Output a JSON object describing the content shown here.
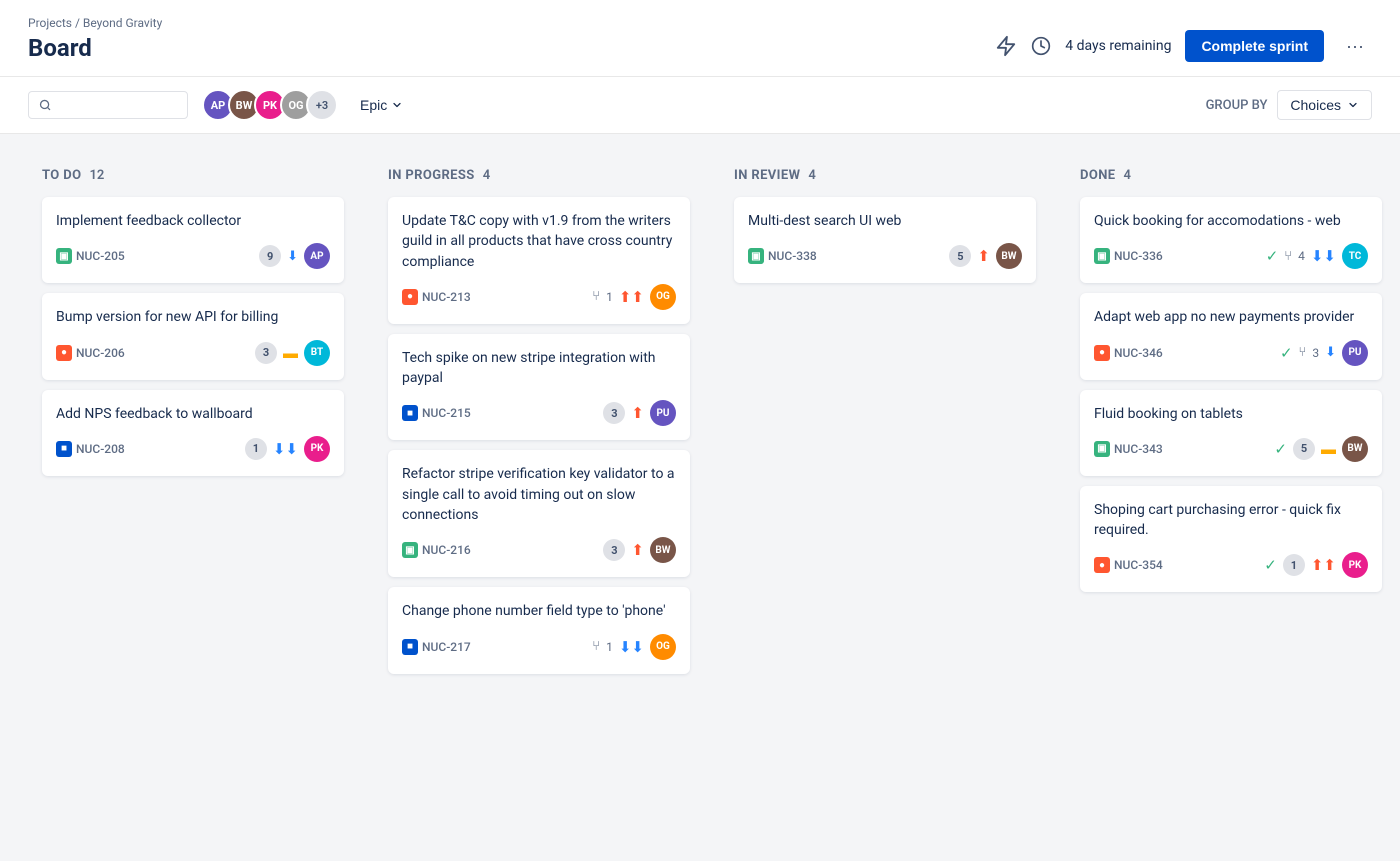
{
  "breadcrumb": "Projects / Beyond Gravity",
  "page_title": "Board",
  "sprint_timer": "4 days remaining",
  "complete_sprint_label": "Complete sprint",
  "more_options_label": "···",
  "toolbar": {
    "search_placeholder": "",
    "epic_label": "Epic",
    "group_by_label": "GROUP BY",
    "choices_label": "Choices",
    "avatar_extra": "+3"
  },
  "columns": [
    {
      "id": "todo",
      "title": "TO DO",
      "count": 12,
      "cards": [
        {
          "id": "c1",
          "title": "Implement feedback collector",
          "issue_id": "NUC-205",
          "issue_type": "story",
          "story_points": 9,
          "priority": "down",
          "avatar_color": "av-purple",
          "avatar_initials": "AP"
        },
        {
          "id": "c2",
          "title": "Bump version for new API for billing",
          "issue_id": "NUC-206",
          "issue_type": "bug",
          "story_points": 3,
          "priority": "medium",
          "avatar_color": "av-teal",
          "avatar_initials": "BT"
        },
        {
          "id": "c3",
          "title": "Add NPS feedback to wallboard",
          "issue_id": "NUC-208",
          "issue_type": "task",
          "story_points": 1,
          "priority": "low",
          "avatar_color": "av-pink",
          "avatar_initials": "PK"
        }
      ]
    },
    {
      "id": "inprogress",
      "title": "IN PROGRESS",
      "count": 4,
      "cards": [
        {
          "id": "c4",
          "title": "Update T&C copy with v1.9 from the writers guild in all products that have cross country compliance",
          "issue_id": "NUC-213",
          "issue_type": "bug",
          "story_points": null,
          "has_branch": true,
          "branch_count": 1,
          "priority": "highest",
          "avatar_color": "av-orange",
          "avatar_initials": "OG"
        },
        {
          "id": "c5",
          "title": "Tech spike on new stripe integration with paypal",
          "issue_id": "NUC-215",
          "issue_type": "task",
          "story_points": 3,
          "priority": "high",
          "avatar_color": "av-purple",
          "avatar_initials": "PU"
        },
        {
          "id": "c6",
          "title": "Refactor stripe verification key validator to a single call to avoid timing out on slow connections",
          "issue_id": "NUC-216",
          "issue_type": "story",
          "story_points": 3,
          "priority": "high",
          "avatar_color": "av-brown",
          "avatar_initials": "BW"
        },
        {
          "id": "c7",
          "title": "Change phone number field type to 'phone'",
          "issue_id": "NUC-217",
          "issue_type": "task",
          "story_points": null,
          "has_branch": true,
          "branch_count": 1,
          "priority": "low",
          "avatar_color": "av-orange",
          "avatar_initials": "OG"
        }
      ]
    },
    {
      "id": "inreview",
      "title": "IN REVIEW",
      "count": 4,
      "cards": [
        {
          "id": "c8",
          "title": "Multi-dest search UI web",
          "issue_id": "NUC-338",
          "issue_type": "story",
          "story_points": 5,
          "priority": "high",
          "avatar_color": "av-brown",
          "avatar_initials": "BW"
        }
      ]
    },
    {
      "id": "done",
      "title": "DONE",
      "count": 4,
      "cards": [
        {
          "id": "c9",
          "title": "Quick booking for accomodations - web",
          "issue_id": "NUC-336",
          "issue_type": "story",
          "has_check": true,
          "has_branch": true,
          "branch_count": 4,
          "priority": "low",
          "avatar_color": "av-teal",
          "avatar_initials": "TC"
        },
        {
          "id": "c10",
          "title": "Adapt web app no new payments provider",
          "issue_id": "NUC-346",
          "issue_type": "bug",
          "has_check": true,
          "has_branch": true,
          "branch_count": 3,
          "priority": "down",
          "avatar_color": "av-purple",
          "avatar_initials": "PU"
        },
        {
          "id": "c11",
          "title": "Fluid booking on tablets",
          "issue_id": "NUC-343",
          "issue_type": "story",
          "has_check": true,
          "story_points": 5,
          "priority": "medium",
          "avatar_color": "av-brown",
          "avatar_initials": "BW"
        },
        {
          "id": "c12",
          "title": "Shoping cart purchasing error - quick fix required.",
          "issue_id": "NUC-354",
          "issue_type": "bug",
          "has_check": true,
          "story_points": 1,
          "priority": "highest",
          "avatar_color": "av-pink",
          "avatar_initials": "PK"
        }
      ]
    }
  ],
  "toolbar_avatars": [
    {
      "color": "#6554c0",
      "initials": "AP"
    },
    {
      "color": "#795548",
      "initials": "BW"
    },
    {
      "color": "#e91e8c",
      "initials": "PK"
    },
    {
      "color": "#ff8b00",
      "initials": "OG"
    }
  ]
}
